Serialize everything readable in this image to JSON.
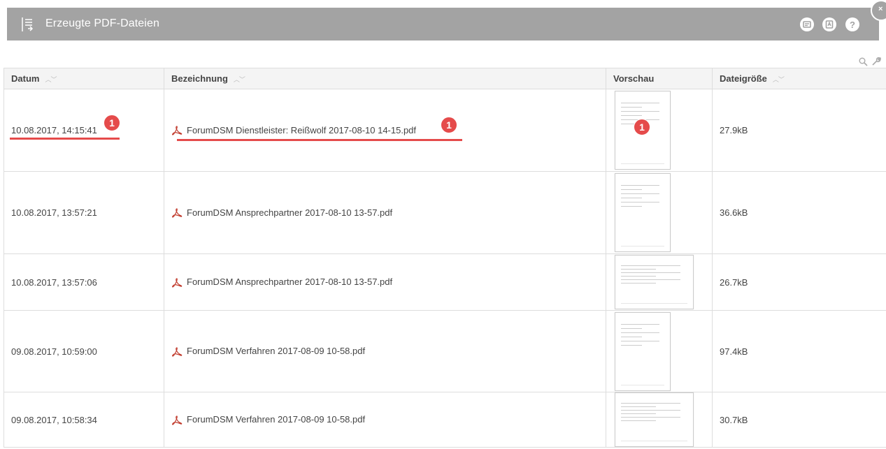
{
  "window": {
    "title": "Erzeugte PDF-Dateien",
    "close_label": "×"
  },
  "toolbar": {
    "icons": [
      "menu-icon",
      "document-icon",
      "pdf-icon",
      "help-icon",
      "search-icon",
      "wrench-icon"
    ],
    "help_label": "?"
  },
  "table": {
    "columns": [
      {
        "label": "Datum",
        "sortable": true
      },
      {
        "label": "Bezeichnung",
        "sortable": true
      },
      {
        "label": "Vorschau",
        "sortable": false
      },
      {
        "label": "Dateigröße",
        "sortable": true
      }
    ],
    "rows": [
      {
        "date": "10.08.2017, 14:15:41",
        "name": "ForumDSM Dienstleister: Reißwolf 2017-08-10 14-15.pdf",
        "orientation": "portrait",
        "size": "27.9kB",
        "badge": "1"
      },
      {
        "date": "10.08.2017, 13:57:21",
        "name": "ForumDSM Ansprechpartner 2017-08-10 13-57.pdf",
        "orientation": "portrait",
        "size": "36.6kB"
      },
      {
        "date": "10.08.2017, 13:57:06",
        "name": "ForumDSM Ansprechpartner 2017-08-10 13-57.pdf",
        "orientation": "landscape",
        "size": "26.7kB"
      },
      {
        "date": "09.08.2017, 10:59:00",
        "name": "ForumDSM Verfahren 2017-08-09 10-58.pdf",
        "orientation": "portrait",
        "size": "97.4kB"
      },
      {
        "date": "09.08.2017, 10:58:34",
        "name": "ForumDSM Verfahren 2017-08-09 10-58.pdf",
        "orientation": "landscape",
        "size": "30.7kB"
      }
    ]
  },
  "colors": {
    "titlebar": "#a3a3a3",
    "annotation": "#e54b4b",
    "pdf_icon": "#c0392b"
  }
}
